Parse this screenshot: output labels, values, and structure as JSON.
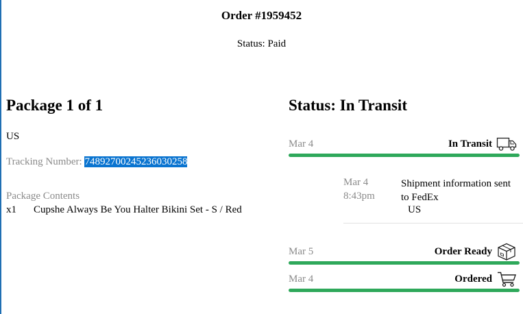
{
  "order": {
    "title": "Order #1959452",
    "status": "Status: Paid"
  },
  "package": {
    "title": "Package 1 of 1",
    "country": "US",
    "tracking_label": "Tracking Number: ",
    "tracking_number": "748927002452360302​58",
    "contents_label": "Package Contents",
    "items": [
      {
        "qty": "x1",
        "name": "Cupshe Always Be You Halter Bikini Set - S / Red"
      }
    ]
  },
  "shipment": {
    "title": "Status: In Transit",
    "events": [
      {
        "date": "Mar 4",
        "label": "In Transit",
        "icon": "truck-icon"
      },
      {
        "date": "Mar 5",
        "label": "Order Ready",
        "icon": "package-box-icon"
      },
      {
        "date": "Mar 4",
        "label": "Ordered",
        "icon": "shopping-cart-icon"
      }
    ],
    "detail": {
      "date": "Mar 4",
      "time": "8:43pm",
      "text": "Shipment information sent to FedEx",
      "location": "US"
    }
  },
  "colors": {
    "progress_bar": "#2ea85a",
    "selection": "#0a74d0",
    "muted_text": "#8a8a8a"
  }
}
